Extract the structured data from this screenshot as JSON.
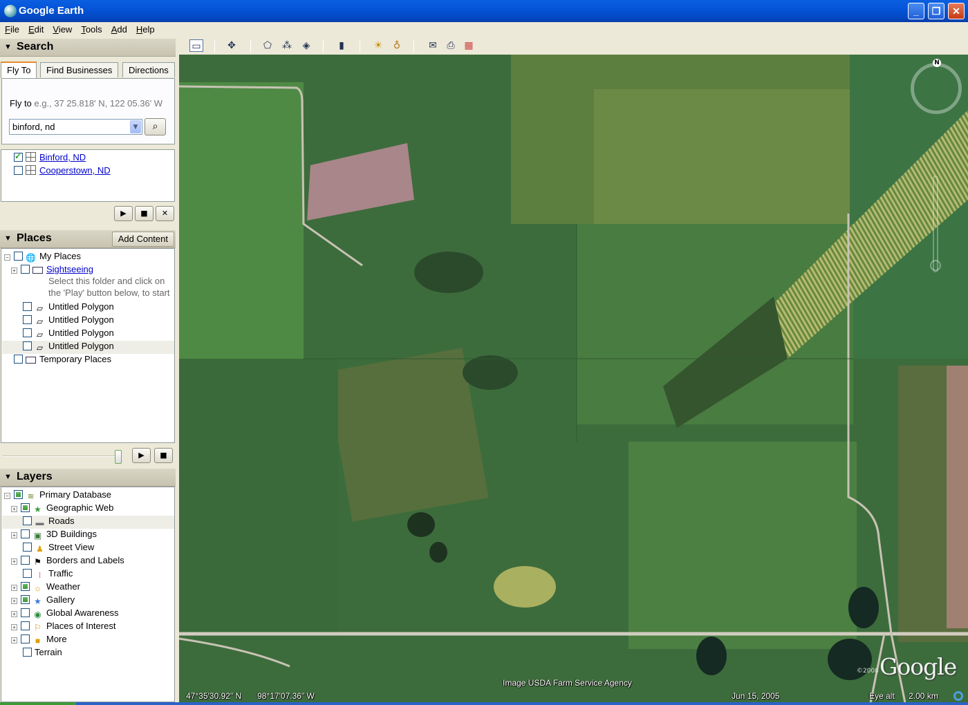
{
  "window": {
    "title": "Google Earth"
  },
  "menu": [
    "File",
    "Edit",
    "View",
    "Tools",
    "Add",
    "Help"
  ],
  "search": {
    "header": "Search",
    "tabs": [
      "Fly To",
      "Find Businesses",
      "Directions"
    ],
    "fly_to_label": "Fly to",
    "fly_to_hint": "e.g., 37 25.818' N, 122 05.36' W",
    "fly_to_value": "binford, nd",
    "results": [
      {
        "label": "Binford, ND",
        "checked": true
      },
      {
        "label": "Cooperstown, ND",
        "checked": false
      }
    ]
  },
  "places": {
    "header": "Places",
    "add_content": "Add Content",
    "my_places": "My Places",
    "sightseeing": "Sightseeing",
    "sightseeing_desc_1": "Select this folder and click on",
    "sightseeing_desc_2": "the 'Play' button below, to start",
    "polygons": [
      "Untitled Polygon",
      "Untitled Polygon",
      "Untitled Polygon",
      "Untitled Polygon"
    ],
    "temporary": "Temporary Places"
  },
  "layers": {
    "header": "Layers",
    "items": [
      "Primary Database",
      "Geographic Web",
      "Roads",
      "3D Buildings",
      "Street View",
      "Borders and Labels",
      "Traffic",
      "Weather",
      "Gallery",
      "Global Awareness",
      "Places of Interest",
      "More",
      "Terrain"
    ]
  },
  "map": {
    "compass_north": "N",
    "attribution": "Image USDA Farm Service Agency",
    "copyright_year": "©2008",
    "logo": "Google",
    "lat": "47°35'30.92\" N",
    "lon": "98°17'07.36\" W",
    "date": "Jun 15, 2005",
    "eye_alt_label": "Eye alt",
    "eye_alt_value": "2.00 km"
  },
  "colors": {
    "titlebar": "#0555d8",
    "chrome": "#ece9d8",
    "link": "#0000cc",
    "tab_accent": "#e68b2c"
  }
}
